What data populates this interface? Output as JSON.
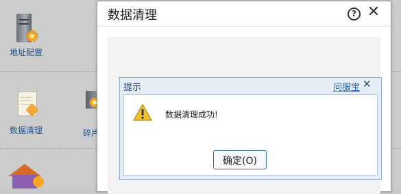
{
  "background": {
    "tiles": [
      {
        "label": "地址配置"
      },
      {
        "label": "数据清理"
      },
      {
        "label": "碎片"
      }
    ]
  },
  "main_dialog": {
    "title": "数据清理",
    "help_icon": "?",
    "close_icon": "✕"
  },
  "alert_dialog": {
    "title": "提示",
    "link": "问服宝",
    "close_icon": "✕",
    "message": "数据清理成功!",
    "ok_button": "确定(O)"
  },
  "colors": {
    "link": "#1a5fb4",
    "alert_title": "#1a3f78",
    "ok_border": "#2a6f8d",
    "warning": "#f2c230"
  }
}
